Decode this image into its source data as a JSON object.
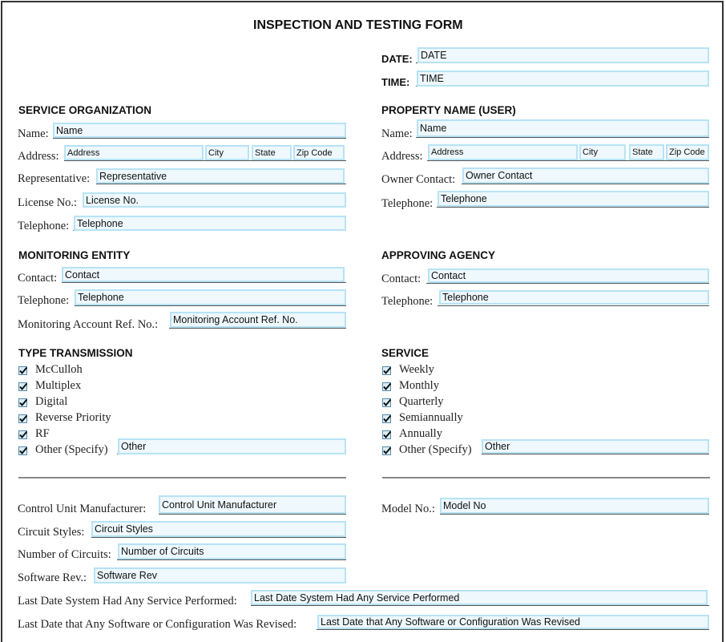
{
  "form": {
    "title": "INSPECTION AND TESTING FORM",
    "date": {
      "label": "DATE:",
      "value": "DATE"
    },
    "time": {
      "label": "TIME:",
      "value": "TIME"
    }
  },
  "service_organization": {
    "heading": "SERVICE ORGANIZATION",
    "name": {
      "label": "Name:",
      "value": "Name"
    },
    "address": {
      "label": "Address:",
      "address": "Address",
      "city": "City",
      "state": "State",
      "zip": "Zip Code"
    },
    "representative": {
      "label": "Representative:",
      "value": "Representative"
    },
    "license": {
      "label": "License No.:",
      "value": "License No."
    },
    "telephone": {
      "label": "Telephone:",
      "value": "Telephone"
    }
  },
  "property": {
    "heading": "PROPERTY NAME (USER)",
    "name": {
      "label": "Name:",
      "value": "Name"
    },
    "address": {
      "label": "Address:",
      "address": "Address",
      "city": "City",
      "state": "State",
      "zip": "Zip Code"
    },
    "owner_contact": {
      "label": "Owner Contact:",
      "value": "Owner Contact"
    },
    "telephone": {
      "label": "Telephone:",
      "value": "Telephone"
    }
  },
  "monitoring_entity": {
    "heading": "MONITORING ENTITY",
    "contact": {
      "label": "Contact:",
      "value": "Contact"
    },
    "telephone": {
      "label": "Telephone:",
      "value": "Telephone"
    },
    "account_ref": {
      "label": "Monitoring Account Ref. No.:",
      "value": "Monitoring Account Ref. No."
    }
  },
  "approving_agency": {
    "heading": "APPROVING AGENCY",
    "contact": {
      "label": "Contact:",
      "value": "Contact"
    },
    "telephone": {
      "label": "Telephone:",
      "value": "Telephone"
    }
  },
  "type_transmission": {
    "heading": "TYPE TRANSMISSION",
    "options": [
      "McCulloh",
      "Multiplex",
      "Digital",
      "Reverse Priority",
      "RF",
      "Other (Specify)"
    ],
    "other_value": "Other"
  },
  "service": {
    "heading": "SERVICE",
    "options": [
      "Weekly",
      "Monthly",
      "Quarterly",
      "Semiannually",
      "Annually",
      "Other (Specify)"
    ],
    "other_value": "Other"
  },
  "system": {
    "control_unit": {
      "label": "Control Unit Manufacturer:",
      "value": "Control Unit Manufacturer"
    },
    "model_no": {
      "label": "Model No.:",
      "value": "Model No"
    },
    "circuit_styles": {
      "label": "Circuit Styles:",
      "value": "Circuit Styles"
    },
    "num_circuits": {
      "label": "Number of Circuits:",
      "value": "Number of Circuits"
    },
    "software_rev": {
      "label": "Software Rev.:",
      "value": "Software Rev"
    },
    "last_service": {
      "label": "Last Date System Had Any Service Performed:",
      "value": "Last Date System Had Any Service Performed"
    },
    "last_revised": {
      "label": "Last Date that Any Software or Configuration Was Revised:",
      "value": "Last Date that Any Software or Configuration Was Revised"
    }
  }
}
